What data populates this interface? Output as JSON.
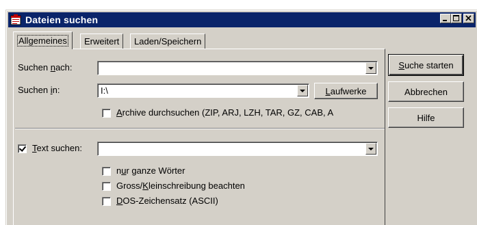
{
  "window": {
    "title": "Dateien suchen"
  },
  "tabs": [
    {
      "label": "Allgemeines",
      "active": true
    },
    {
      "label": "Erweitert",
      "active": false
    },
    {
      "label": "Laden/Speichern",
      "active": false
    }
  ],
  "search": {
    "name_label_pre": "Suchen ",
    "name_label_key": "n",
    "name_label_post": "ach:",
    "name_value": "",
    "dir_label_pre": "Suchen ",
    "dir_label_key": "i",
    "dir_label_post": "n:",
    "dir_value": "I:\\",
    "drives_button_key": "L",
    "drives_button_rest": "aufwerke",
    "archives_key": "A",
    "archives_rest": "rchive durchsuchen (ZIP, ARJ, LZH, TAR, GZ, CAB, A",
    "archives_checked": false
  },
  "text_search": {
    "label_key": "T",
    "label_rest": "ext suchen:",
    "checked": true,
    "value": "",
    "whole_words_pre": "n",
    "whole_words_key": "u",
    "whole_words_rest": "r ganze Wörter",
    "whole_words_checked": false,
    "case_pre": "Gross/",
    "case_key": "K",
    "case_rest": "leinschreibung beachten",
    "case_checked": false,
    "dos_key": "D",
    "dos_rest": "OS-Zeichensatz (ASCII)",
    "dos_checked": false
  },
  "buttons": {
    "start_key": "S",
    "start_rest": "uche starten",
    "cancel": "Abbrechen",
    "help": "Hilfe"
  },
  "colors": {
    "title_bar": "#0a246a",
    "face": "#d4d0c8"
  }
}
